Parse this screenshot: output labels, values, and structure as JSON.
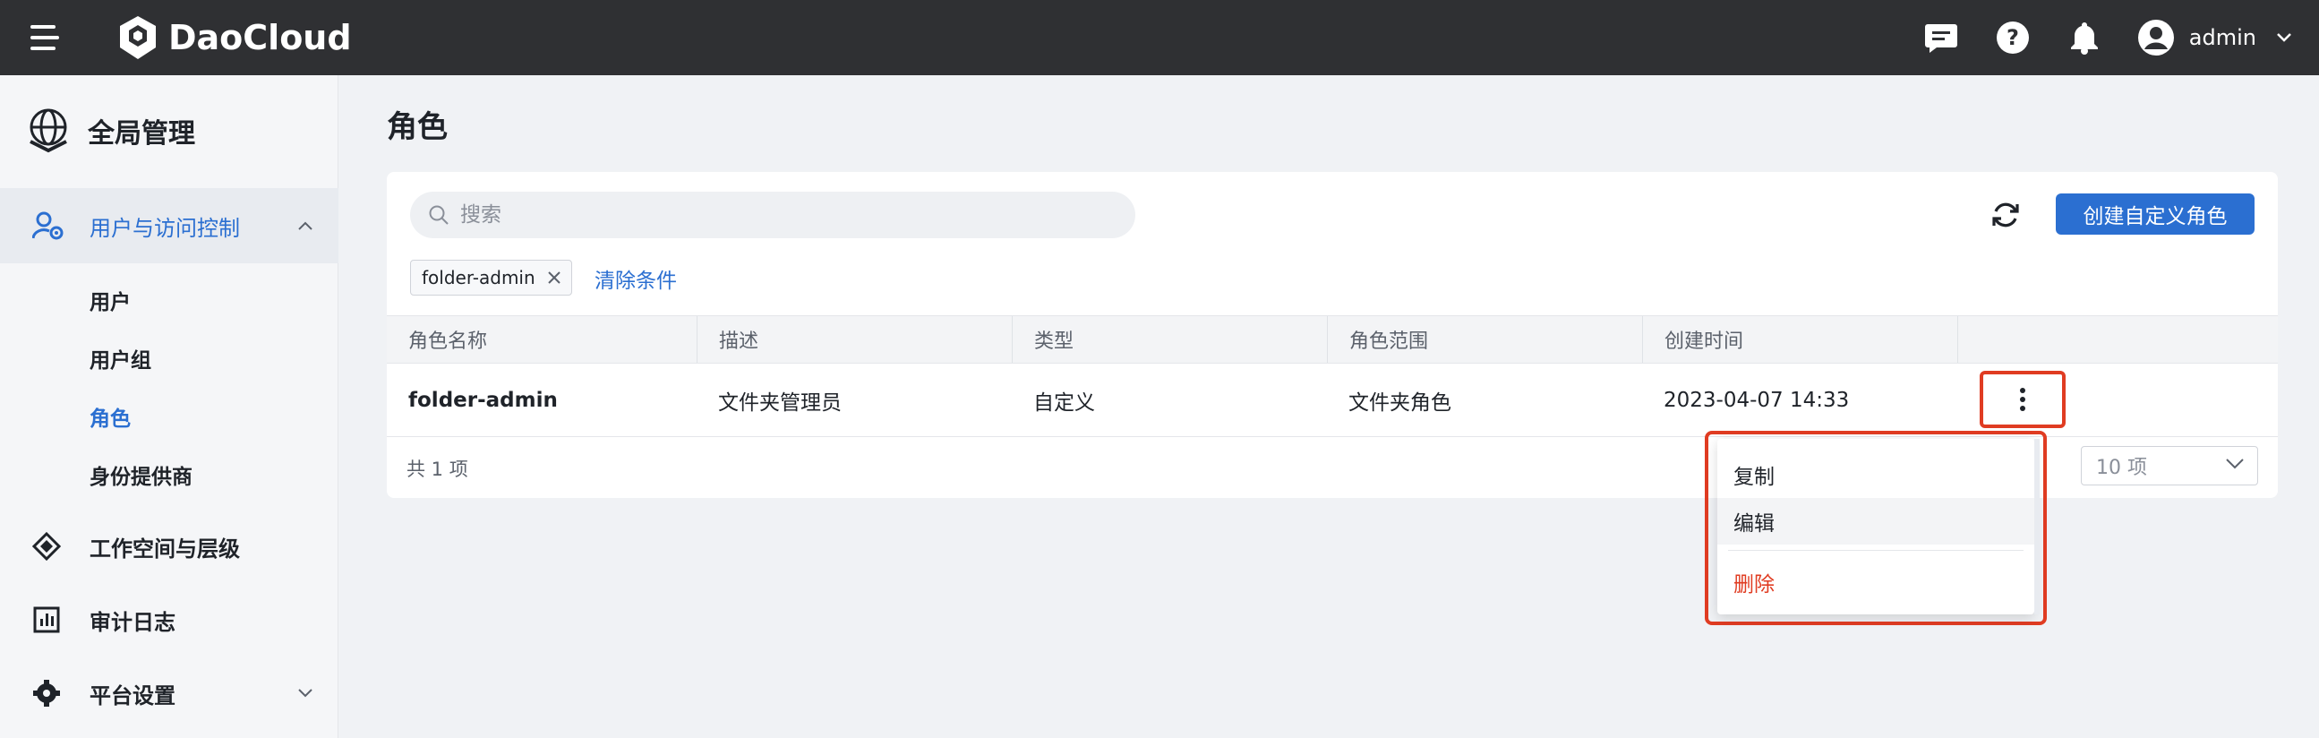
{
  "topbar": {
    "brand": "DaoCloud",
    "user_name": "admin",
    "icons": [
      "hamburger-menu-icon",
      "daocloud-logo-icon",
      "message-icon",
      "help-icon",
      "bell-icon",
      "user-avatar-icon",
      "chevron-down-icon"
    ]
  },
  "sidebar": {
    "header": "全局管理",
    "group_label": "用户与访问控制",
    "sub_items": [
      "用户",
      "用户组",
      "角色",
      "身份提供商"
    ],
    "active_sub": "角色",
    "nav_items": [
      "工作空间与层级",
      "审计日志",
      "平台设置"
    ]
  },
  "main": {
    "title": "角色",
    "search_placeholder": "搜索",
    "create_button": "创建自定义角色",
    "filter_tag": "folder-admin",
    "clear_filter": "清除条件",
    "columns": [
      "角色名称",
      "描述",
      "类型",
      "角色范围",
      "创建时间"
    ],
    "rows": [
      {
        "name": "folder-admin",
        "desc": "文件夹管理员",
        "type": "自定义",
        "scope": "文件夹角色",
        "created": "2023-04-07 14:33"
      }
    ],
    "total": "共 1 项",
    "page_size": "10 项"
  },
  "menu": {
    "items": [
      "复制",
      "编辑",
      "删除"
    ]
  },
  "colors": {
    "accent": "#2b6fd1",
    "topbar": "#2f3033",
    "highlight": "#e03c22",
    "danger": "#e03c22"
  }
}
